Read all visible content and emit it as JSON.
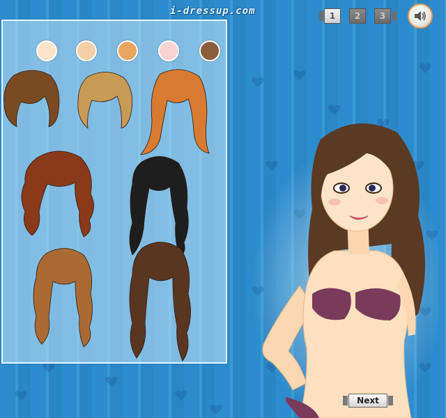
{
  "site": {
    "logo_text": "i-dressup.com"
  },
  "skin_tones": [
    {
      "name": "fair",
      "color": "#fde3c7"
    },
    {
      "name": "light",
      "color": "#f2cfa4"
    },
    {
      "name": "tan",
      "color": "#e8a560"
    },
    {
      "name": "rosy",
      "color": "#fbd2d2"
    },
    {
      "name": "dark",
      "color": "#8a5e3a"
    }
  ],
  "hair_styles": [
    {
      "name": "short-brown-bob",
      "color": "#7a4a22"
    },
    {
      "name": "short-blonde-bob",
      "color": "#c79a55"
    },
    {
      "name": "long-orange-straight",
      "color": "#d97a32"
    },
    {
      "name": "medium-auburn-wavy",
      "color": "#8a3a1a"
    },
    {
      "name": "long-black-wavy",
      "color": "#1e1e1e"
    },
    {
      "name": "medium-light-brown-wavy",
      "color": "#a96b33"
    },
    {
      "name": "long-dark-brown-wavy",
      "color": "#5a3520"
    }
  ],
  "pages": {
    "items": [
      "1",
      "2",
      "3"
    ],
    "active": "1"
  },
  "controls": {
    "next_label": "Next",
    "sound_icon": "speaker-icon"
  },
  "colors": {
    "background": "#2f8fcf",
    "accent": "#f29a4b",
    "model_hair": "#5a3a22",
    "bikini": "#7a3a5a"
  }
}
